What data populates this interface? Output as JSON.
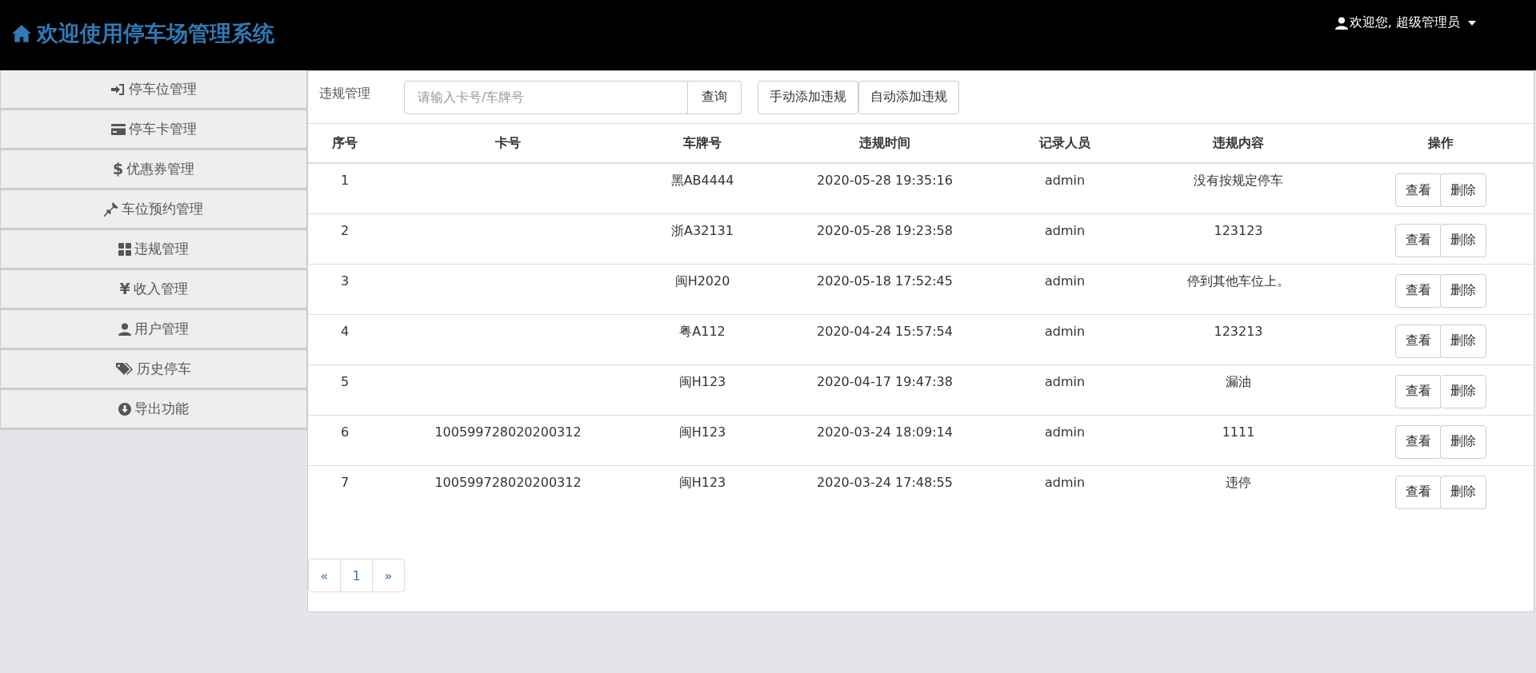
{
  "header": {
    "title": "欢迎使用停车场管理系统",
    "user_menu": "欢迎您, 超级管理员"
  },
  "sidebar": {
    "items": [
      {
        "label": "停车位管理"
      },
      {
        "label": "停车卡管理"
      },
      {
        "label": "优惠券管理",
        "glyph": "$"
      },
      {
        "label": "车位预约管理"
      },
      {
        "label": "违规管理"
      },
      {
        "label": "收入管理",
        "glyph": "¥"
      },
      {
        "label": "用户管理"
      },
      {
        "label": "历史停车"
      },
      {
        "label": "导出功能"
      }
    ]
  },
  "toolbar": {
    "label": "违规管理",
    "search": {
      "placeholder": "请输入卡号/车牌号"
    },
    "search_button": "查询",
    "buttons": [
      "手动添加违规",
      "自动添加违规"
    ]
  },
  "table": {
    "columns": [
      "序号",
      "卡号",
      "车牌号",
      "违规时间",
      "记录人员",
      "违规内容",
      "操作"
    ],
    "rows": [
      {
        "cells": [
          "1",
          "",
          "黑AB4444",
          "2020-05-28 19:35:16",
          "admin",
          "没有按规定停车"
        ],
        "actions": [
          "查看",
          "删除"
        ]
      },
      {
        "cells": [
          "2",
          "",
          "浙A32131",
          "2020-05-28 19:23:58",
          "admin",
          "123123"
        ],
        "actions": [
          "查看",
          "删除"
        ]
      },
      {
        "cells": [
          "3",
          "",
          "闽H2020",
          "2020-05-18 17:52:45",
          "admin",
          "停到其他车位上。"
        ],
        "actions": [
          "查看",
          "删除"
        ]
      },
      {
        "cells": [
          "4",
          "",
          "粤A112",
          "2020-04-24 15:57:54",
          "admin",
          "123213"
        ],
        "actions": [
          "查看",
          "删除"
        ]
      },
      {
        "cells": [
          "5",
          "",
          "闽H123",
          "2020-04-17 19:47:38",
          "admin",
          "漏油"
        ],
        "actions": [
          "查看",
          "删除"
        ]
      },
      {
        "cells": [
          "6",
          "100599728020200312",
          "闽H123",
          "2020-03-24 18:09:14",
          "admin",
          "1111"
        ],
        "actions": [
          "查看",
          "删除"
        ]
      },
      {
        "cells": [
          "7",
          "100599728020200312",
          "闽H123",
          "2020-03-24 17:48:55",
          "admin",
          "违停"
        ],
        "actions": [
          "查看",
          "删除"
        ]
      }
    ]
  },
  "pagination": {
    "prev": "«",
    "pages": [
      {
        "label": "1",
        "selected": false
      }
    ],
    "next": "»"
  }
}
